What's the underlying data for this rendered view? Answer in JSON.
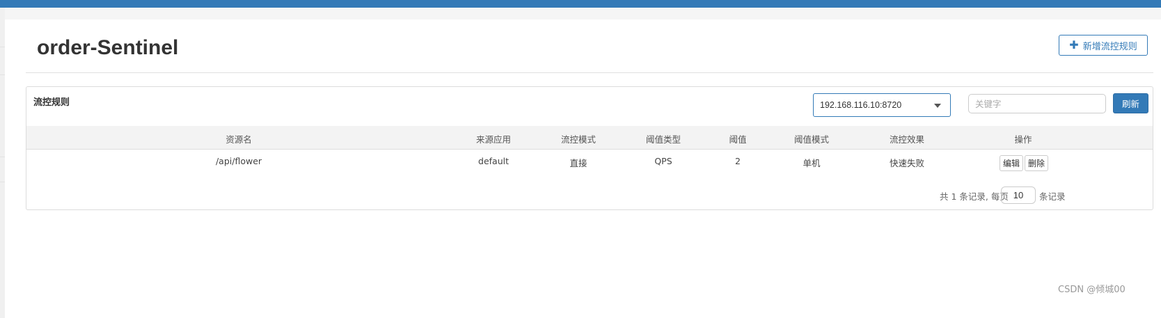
{
  "header": {
    "title": "order-Sentinel",
    "add_button_label": "新增流控规则",
    "add_button_icon": "plus-icon"
  },
  "panel": {
    "heading": "流控规则",
    "machine_select": "192.168.116.10:8720",
    "search_placeholder": "关键字",
    "refresh_label": "刷新"
  },
  "table": {
    "columns": [
      "资源名",
      "来源应用",
      "流控模式",
      "阈值类型",
      "阈值",
      "阈值模式",
      "流控效果",
      "操作"
    ],
    "rows": [
      {
        "resource": "/api/flower",
        "limit_app": "default",
        "strategy": "直接",
        "grade": "QPS",
        "count": "2",
        "cluster_mode": "单机",
        "control_behavior": "快速失败",
        "edit_label": "编辑",
        "delete_label": "删除"
      }
    ]
  },
  "pagination": {
    "summary": "共 1 条记录, 每页",
    "page_size": "10",
    "suffix": "条记录"
  },
  "watermark": "CSDN @倾城00",
  "colors": {
    "primary": "#337ab7",
    "header_bar": "#337ab7",
    "table_header_bg": "#f3f3f3"
  }
}
